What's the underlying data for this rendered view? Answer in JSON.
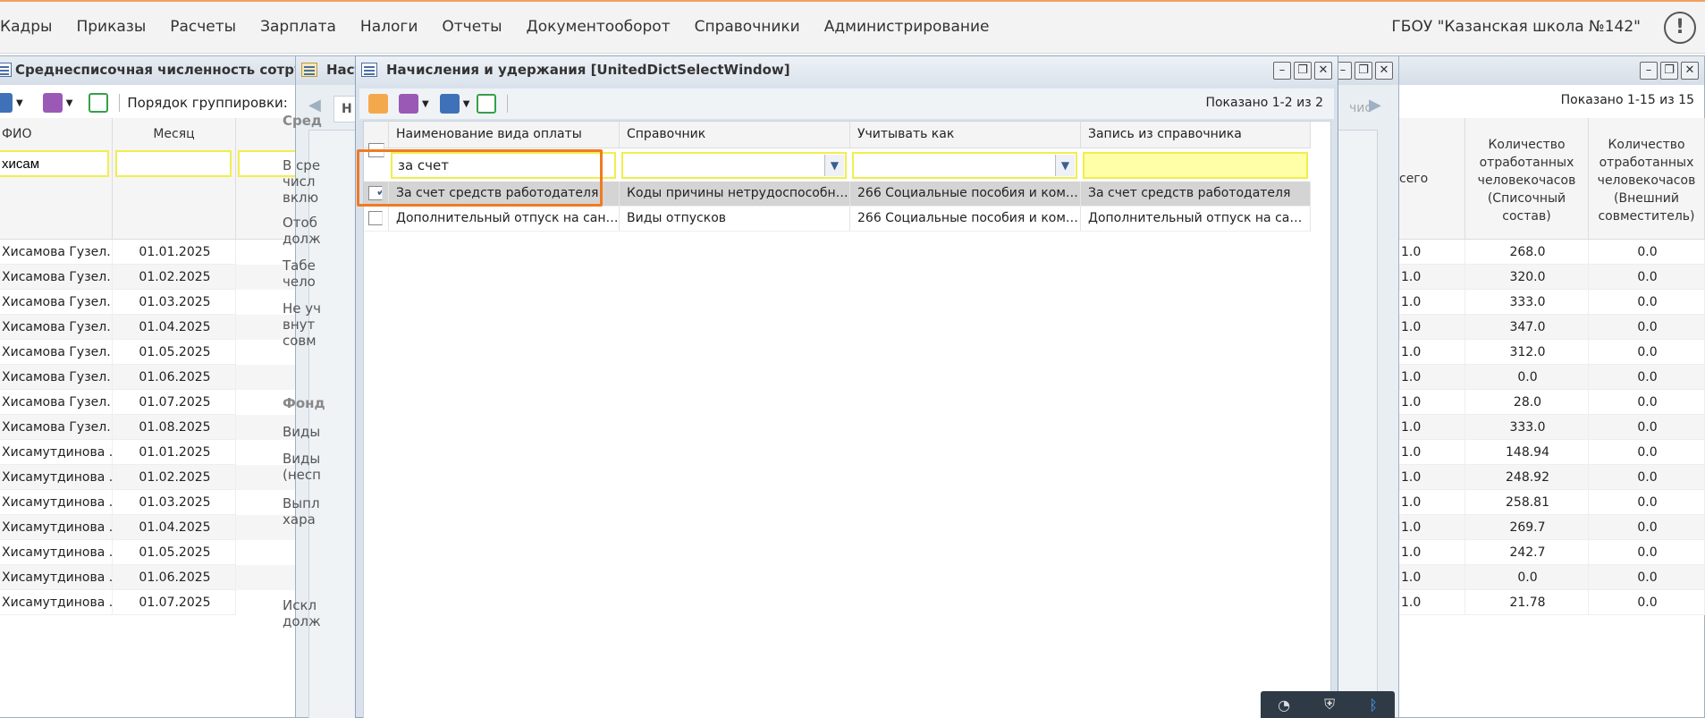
{
  "topbar": {
    "menu": [
      "Кадры",
      "Приказы",
      "Расчеты",
      "Зарплата",
      "Налоги",
      "Отчеты",
      "Документооборот",
      "Справочники",
      "Администрирование"
    ],
    "org": "ГБОУ \"Казанская школа №142\"",
    "alert": "!"
  },
  "bg_window": {
    "title": "Среднесписочная численность сотрудн",
    "group_label": "Порядок группировки:",
    "shown": "Показано 1-15 из 15",
    "columns": {
      "fio": "ФИО",
      "month": "Месяц",
      "total": "сего",
      "hours_list": "Количество отработанных человекочасов (Списочный состав)",
      "hours_ext": "Количество отработанных человекочасов (Внешний совместитель)"
    },
    "filter_fio": "хисам",
    "rows": [
      {
        "fio": "Хисамова Гузел...",
        "month": "01.01.2025",
        "total": "1.0",
        "h1": "268.0",
        "h2": "0.0"
      },
      {
        "fio": "Хисамова Гузел...",
        "month": "01.02.2025",
        "total": "1.0",
        "h1": "320.0",
        "h2": "0.0"
      },
      {
        "fio": "Хисамова Гузел...",
        "month": "01.03.2025",
        "total": "1.0",
        "h1": "333.0",
        "h2": "0.0"
      },
      {
        "fio": "Хисамова Гузел...",
        "month": "01.04.2025",
        "total": "1.0",
        "h1": "347.0",
        "h2": "0.0"
      },
      {
        "fio": "Хисамова Гузел...",
        "month": "01.05.2025",
        "total": "1.0",
        "h1": "312.0",
        "h2": "0.0"
      },
      {
        "fio": "Хисамова Гузел...",
        "month": "01.06.2025",
        "total": "1.0",
        "h1": "0.0",
        "h2": "0.0"
      },
      {
        "fio": "Хисамова Гузел...",
        "month": "01.07.2025",
        "total": "1.0",
        "h1": "28.0",
        "h2": "0.0"
      },
      {
        "fio": "Хисамова Гузел...",
        "month": "01.08.2025",
        "total": "1.0",
        "h1": "333.0",
        "h2": "0.0"
      },
      {
        "fio": "Хисамутдинова ...",
        "month": "01.01.2025",
        "total": "1.0",
        "h1": "148.94",
        "h2": "0.0"
      },
      {
        "fio": "Хисамутдинова ...",
        "month": "01.02.2025",
        "total": "1.0",
        "h1": "248.92",
        "h2": "0.0"
      },
      {
        "fio": "Хисамутдинова ...",
        "month": "01.03.2025",
        "total": "1.0",
        "h1": "258.81",
        "h2": "0.0"
      },
      {
        "fio": "Хисамутдинова ...",
        "month": "01.04.2025",
        "total": "1.0",
        "h1": "269.7",
        "h2": "0.0"
      },
      {
        "fio": "Хисамутдинова ...",
        "month": "01.05.2025",
        "total": "1.0",
        "h1": "242.7",
        "h2": "0.0"
      },
      {
        "fio": "Хисамутдинова ...",
        "month": "01.06.2025",
        "total": "1.0",
        "h1": "0.0",
        "h2": "0.0"
      },
      {
        "fio": "Хисамутдинова ...",
        "month": "01.07.2025",
        "total": "1.0",
        "h1": "21.78",
        "h2": "0.0"
      }
    ]
  },
  "mid_window": {
    "title": "Наст",
    "tab": "Н",
    "right_tab": "чис",
    "sections": [
      "Сред",
      "В сре",
      "числ",
      "вклю",
      "Отоб",
      "долж",
      "Табе",
      "чело",
      "Не уч",
      "внут",
      "совм",
      "Фонд",
      "Виды",
      "Виды",
      "(несп",
      "Выпл",
      "хара",
      "Искл",
      "долж"
    ]
  },
  "front_window": {
    "title": "Начисления и удержания [UnitedDictSelectWindow]",
    "shown": "Показано 1-2 из 2",
    "columns": [
      "Наименование вида оплаты",
      "Справочник",
      "Учитывать как",
      "Запись из справочника"
    ],
    "filter_name": "за счет",
    "rows": [
      {
        "checked": true,
        "name": "За счет средств работодателя",
        "dict": "Коды причины нетрудоспособно...",
        "as": "266 Социальные пособия и комп...",
        "record": "За счет средств работодателя"
      },
      {
        "checked": false,
        "name": "Дополнительный отпуск на сана...",
        "dict": "Виды отпусков",
        "as": "266 Социальные пособия и комп...",
        "record": "Дополнительный отпуск на сана..."
      }
    ]
  },
  "colors": {
    "accent": "#f07a22",
    "filter": "#f1ee4e",
    "selected": "#d4d4d4"
  }
}
